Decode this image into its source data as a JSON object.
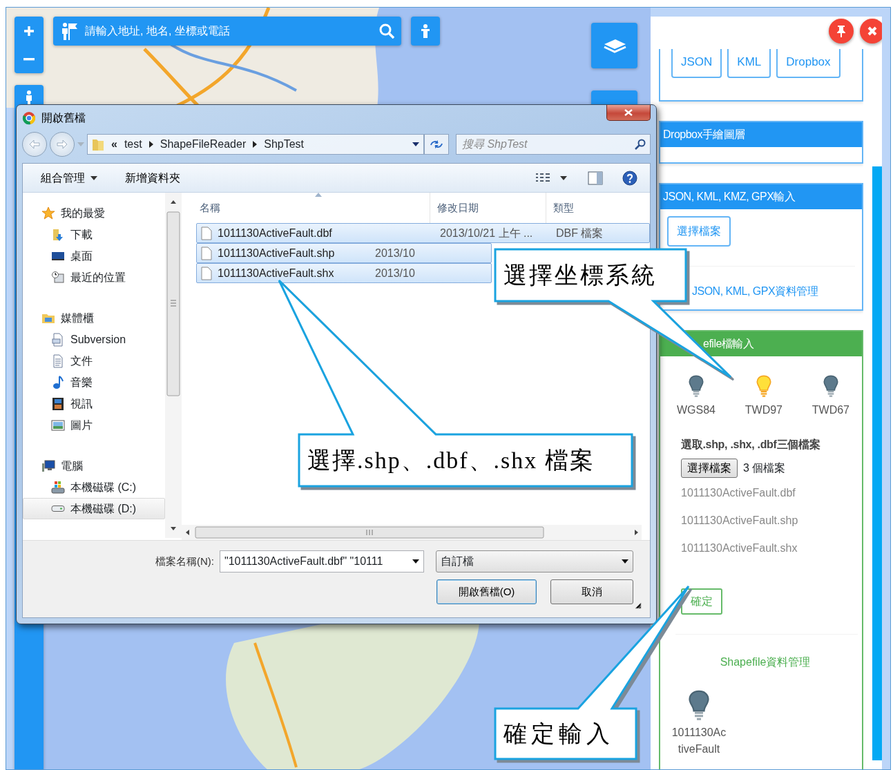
{
  "search": {
    "placeholder": "請輸入地址, 地名, 坐標或電話"
  },
  "dialog": {
    "title": "開啟舊檔",
    "overflow_mark": "«",
    "breadcrumb": [
      "test",
      "ShapeFileReader",
      "ShpTest"
    ],
    "search_placeholder": "搜尋 ShpTest",
    "toolbar": [
      "組合管理",
      "新增資料夾"
    ],
    "nav": [
      {
        "label": "我的最愛",
        "kind": "favorites",
        "selected": false,
        "children": [
          {
            "label": "下載",
            "kind": "downloads",
            "selected": false
          },
          {
            "label": "桌面",
            "kind": "desktop",
            "selected": false
          },
          {
            "label": "最近的位置",
            "kind": "recent",
            "selected": false
          }
        ]
      },
      {
        "label": "媒體櫃",
        "kind": "libraries",
        "selected": false,
        "children": [
          {
            "label": "Subversion",
            "kind": "subversion",
            "selected": false
          },
          {
            "label": "文件",
            "kind": "documents",
            "selected": false
          },
          {
            "label": "音樂",
            "kind": "music",
            "selected": false
          },
          {
            "label": "視訊",
            "kind": "videos",
            "selected": false
          },
          {
            "label": "圖片",
            "kind": "pictures",
            "selected": false
          }
        ]
      },
      {
        "label": "電腦",
        "kind": "computer",
        "selected": false,
        "children": [
          {
            "label": "本機磁碟 (C:)",
            "kind": "system_drive",
            "selected": false
          },
          {
            "label": "本機磁碟 (D:)",
            "kind": "drive",
            "selected": true
          }
        ]
      }
    ],
    "columns": [
      "名稱",
      "修改日期",
      "類型"
    ],
    "files": [
      {
        "name": "1011130ActiveFault.dbf",
        "date": "2013/10/21 上午 ...",
        "type": "DBF 檔案",
        "selected": true
      },
      {
        "name": "1011130ActiveFault.shp",
        "date": "2013/10",
        "selected": true
      },
      {
        "name": "1011130ActiveFault.shx",
        "date": "2013/10",
        "selected": true
      }
    ],
    "filename_label": "檔案名稱(N):",
    "filename_value": "\"1011130ActiveFault.dbf\" \"10111",
    "filter": "自訂檔",
    "buttons": [
      "開啟舊檔(O)",
      "取消"
    ]
  },
  "panel": {
    "export_buttons": [
      "JSON",
      "KML",
      "Dropbox"
    ],
    "dropbox_card": {
      "title": "Dropbox手繪圖層"
    },
    "import_card": {
      "title": "JSON, KML, KMZ, GPX輸入",
      "button": "選擇檔案",
      "link": "JSON, KML, GPX資料管理"
    },
    "shapefile_card": {
      "title": "efile檔輸入",
      "crs": [
        {
          "label": "WGS84",
          "selected": false
        },
        {
          "label": "TWD97",
          "selected": true
        },
        {
          "label": "TWD67",
          "selected": false
        }
      ],
      "instruction": "選取.shp, .shx, .dbf三個檔案",
      "file_button": "選擇檔案",
      "file_count": "3 個檔案",
      "files": [
        "1011130ActiveFault.dbf",
        "1011130ActiveFault.shp",
        "1011130ActiveFault.shx"
      ],
      "confirm": "確定",
      "manage_title": "Shapefile資料管理",
      "layers": [
        {
          "name": "1011130ActiveFault"
        }
      ]
    }
  },
  "callouts": [
    {
      "text": "選擇坐標系統"
    },
    {
      "text": "選擇.shp、.dbf、.shx 檔案"
    },
    {
      "text": "確定輸入"
    }
  ]
}
